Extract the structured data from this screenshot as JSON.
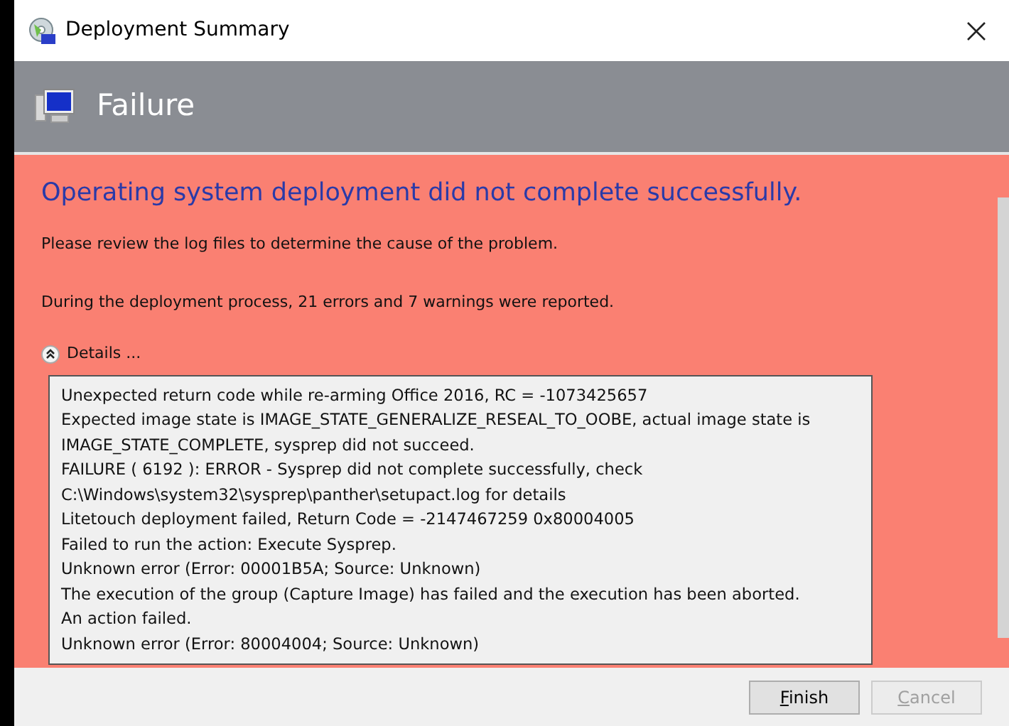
{
  "window": {
    "title": "Deployment Summary"
  },
  "header": {
    "title": "Failure"
  },
  "message": {
    "heading": "Operating system deployment did not complete successfully.",
    "paragraphs": [
      "Please review the log files to determine the cause of the problem.",
      "During the deployment process, 21 errors and 7 warnings were reported."
    ]
  },
  "details": {
    "label": "Details ...",
    "expanded": true,
    "lines": [
      "Unexpected return code while re-arming Office 2016, RC = -1073425657",
      "Expected image state is IMAGE_STATE_GENERALIZE_RESEAL_TO_OOBE, actual image state is",
      "IMAGE_STATE_COMPLETE, sysprep did not succeed.",
      "FAILURE ( 6192 ): ERROR - Sysprep did not complete successfully, check",
      "C:\\Windows\\system32\\sysprep\\panther\\setupact.log for details",
      "Litetouch deployment failed, Return Code = -2147467259  0x80004005",
      "Failed to run the action: Execute Sysprep.",
      "Unknown error (Error: 00001B5A; Source: Unknown)",
      "The execution of the group (Capture Image) has failed and the execution has been aborted.",
      "An action failed.",
      "Unknown error (Error: 80004004; Source: Unknown)"
    ]
  },
  "buttons": [
    {
      "label": "Finish",
      "disabled": false,
      "access_key_shown": true
    },
    {
      "label": "Cancel",
      "disabled": true,
      "access_key_shown": true
    }
  ]
}
